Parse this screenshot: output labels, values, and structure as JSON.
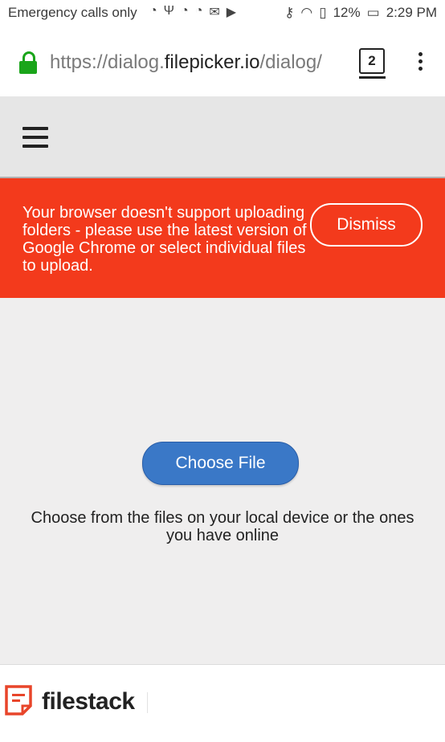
{
  "status_bar": {
    "carrier": "Emergency calls only",
    "battery": "12%",
    "time": "2:29 PM",
    "icons": [
      "firefox-icon",
      "usb-icon",
      "firefox-icon",
      "firefox-icon",
      "gmail-icon",
      "media-icon",
      "key-icon",
      "wifi-icon",
      "alert-icon",
      "battery-icon"
    ]
  },
  "browser": {
    "url_prefix": "https://dialog.",
    "url_host": "filepicker.io",
    "url_suffix": "/dialog/",
    "tab_count": "2"
  },
  "banner": {
    "message": "Your browser doesn't support uploading folders - please use the latest version of Google Chrome or select individual files to upload.",
    "dismiss_label": "Dismiss",
    "color": "#f33a1c"
  },
  "main": {
    "choose_button": "Choose File",
    "description": "Choose from the files on your local device or the ones you have online"
  },
  "footer": {
    "brand": "filestack"
  },
  "colors": {
    "accent": "#3a78c7",
    "lock": "#1aa51a"
  }
}
